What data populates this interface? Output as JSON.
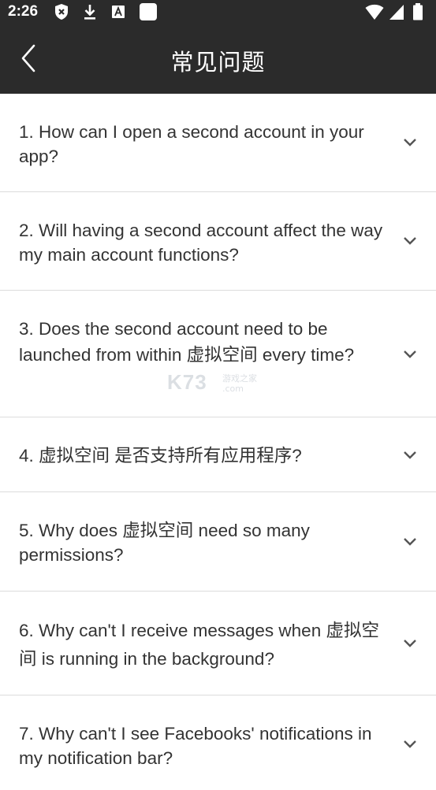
{
  "status_bar": {
    "time": "2:26",
    "icons_left": [
      "shield-icon",
      "download-icon",
      "font-icon",
      "app-square-icon"
    ],
    "icons_right": [
      "wifi-icon",
      "signal-icon",
      "battery-icon"
    ]
  },
  "app_bar": {
    "title": "常见问题",
    "back_icon": "chevron-left-icon"
  },
  "faq": {
    "items": [
      {
        "question": "1. How can I open a second account in your app?"
      },
      {
        "question": "2. Will having a second account affect the way my main account functions?"
      },
      {
        "question": "3. Does the second account need to be launched from within 虚拟空间 every time?"
      },
      {
        "question": "4. 虚拟空间 是否支持所有应用程序?"
      },
      {
        "question": "5. Why does 虚拟空间 need so many permissions?"
      },
      {
        "question": "6. Why can't I receive messages when 虚拟空间 is running in the background?"
      },
      {
        "question": "7. Why can't I see Facebooks' notifications in my notification bar?"
      }
    ]
  },
  "watermark": {
    "main": "K73",
    "sub": "游戏之家",
    "com": ".com"
  },
  "colors": {
    "header_bg": "#2b2b2b",
    "text": "#333333",
    "divider": "#dcdcdc",
    "chevron": "#555555"
  }
}
